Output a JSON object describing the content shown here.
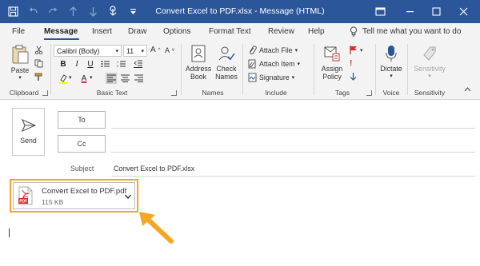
{
  "window": {
    "title": "Convert Excel to PDF.xlsx - Message (HTML)",
    "quick_access": [
      "save-icon",
      "undo-icon",
      "redo-icon",
      "up-icon",
      "down-icon",
      "touch-mode-icon",
      "customize-icon"
    ],
    "controls": [
      "restore-window-icon",
      "minimize-icon",
      "maximize-icon",
      "close-icon"
    ]
  },
  "tabs": [
    {
      "label": "File"
    },
    {
      "label": "Message",
      "active": true
    },
    {
      "label": "Insert"
    },
    {
      "label": "Draw"
    },
    {
      "label": "Options"
    },
    {
      "label": "Format Text"
    },
    {
      "label": "Review"
    },
    {
      "label": "Help"
    }
  ],
  "tell_me": "Tell me what you want to do",
  "ribbon": {
    "clipboard": {
      "paste": "Paste",
      "group": "Clipboard"
    },
    "basic_text": {
      "font": "Calibri (Body)",
      "size": "11",
      "group": "Basic Text"
    },
    "names": {
      "address_book_1": "Address",
      "address_book_2": "Book",
      "check_names_1": "Check",
      "check_names_2": "Names",
      "group": "Names"
    },
    "include": {
      "attach_file": "Attach File",
      "attach_item": "Attach Item",
      "signature": "Signature",
      "group": "Include"
    },
    "tags": {
      "assign_policy_1": "Assign",
      "assign_policy_2": "Policy",
      "group": "Tags"
    },
    "voice": {
      "dictate": "Dictate",
      "group": "Voice"
    },
    "sensitivity": {
      "sensitivity": "Sensitivity",
      "group": "Sensitivity"
    }
  },
  "compose": {
    "send": "Send",
    "to": "To",
    "cc": "Cc",
    "subject_label": "Subject",
    "subject_value": "Convert Excel to PDF.xlsx",
    "attachment": {
      "name": "Convert Excel to PDF.pdf",
      "size": "115 KB",
      "icon": "pdf-file-icon"
    }
  },
  "colors": {
    "title_bar": "#2b579a",
    "highlight": "#f5a623",
    "pdf_red": "#d32f2f"
  }
}
